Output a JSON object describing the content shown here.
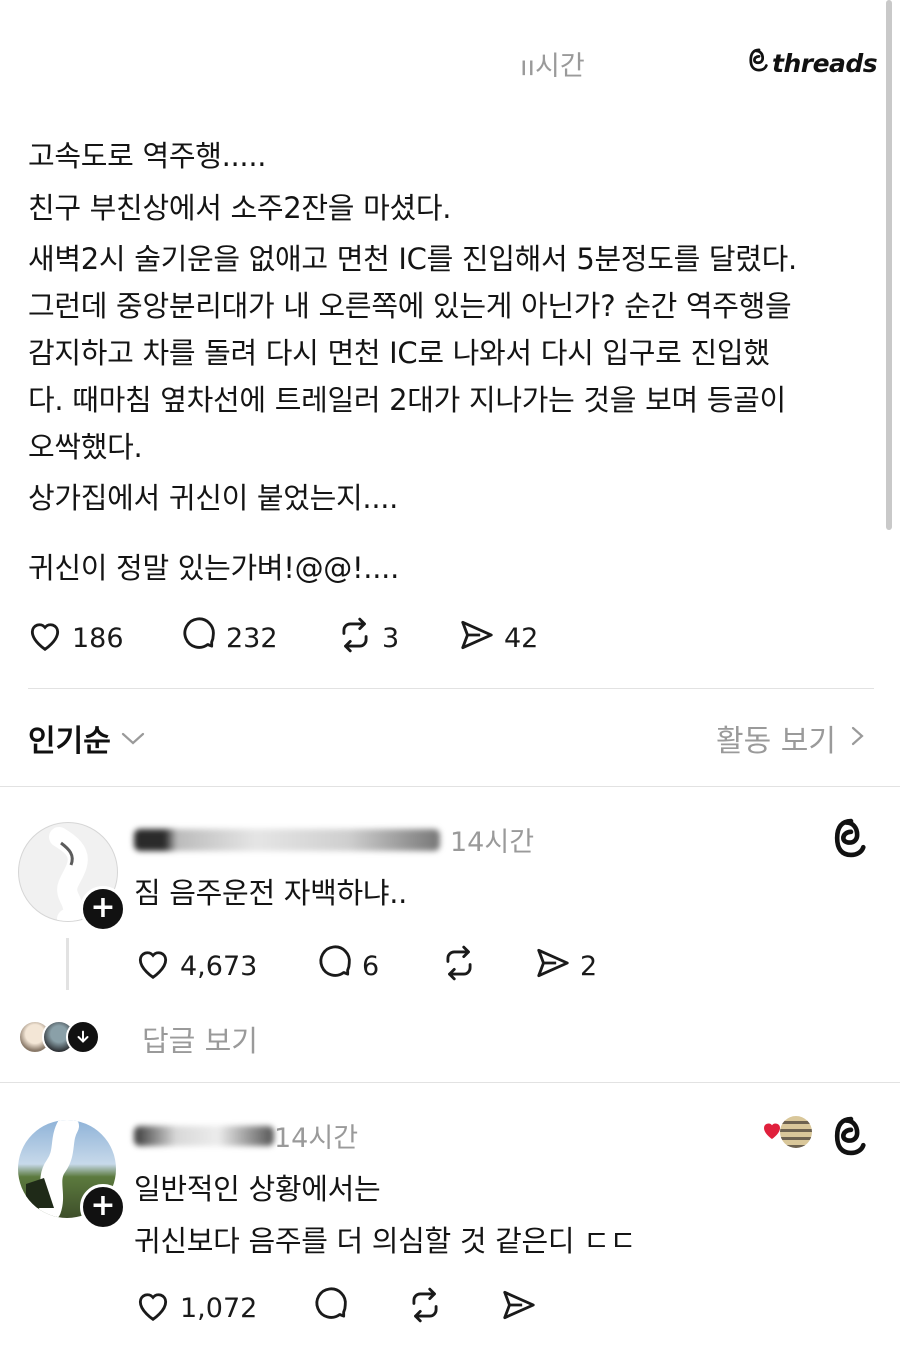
{
  "header": {
    "time": "ıı시간",
    "brand": "threads"
  },
  "post": {
    "lines": [
      "고속도로 역주행.....",
      "친구 부친상에서 소주2잔을 마셨다.",
      "새벽2시 술기운을 없애고 면천 IC를 진입해서 5분정도를 달렸다.",
      "그런데 중앙분리대가 내 오른쪽에  있는게 아닌가? 순간 역주행을",
      "감지하고 차를 돌려 다시 면천 IC로 나와서 다시 입구로 진입했",
      "다. 때마침 옆차선에 트레일러 2대가 지나가는 것을 보며 등골이",
      "오싹했다.",
      "상가집에서 귀신이 붙었는지....",
      "귀신이 정말 있는가벼!@@!...."
    ],
    "likes": "186",
    "replies": "232",
    "reposts": "3",
    "shares": "42"
  },
  "sort": {
    "label": "인기순",
    "activity_label": "활동 보기"
  },
  "comments": [
    {
      "username": "Sha... 14시간",
      "username_blur": "Sha",
      "time": "14시간",
      "text": "짐 음주운전 자백하냐..",
      "likes": "4,673",
      "replies": "6",
      "reposts": "",
      "shares": "2",
      "view_replies": "답글 보기"
    },
    {
      "username_blur": "",
      "time": "14시간",
      "lines": [
        "일반적인 상황에서는",
        "귀신보다 음주를 더 의심할 것 같은디 ㄷㄷ"
      ],
      "likes": "1,072"
    }
  ],
  "colors": {
    "text": "#141414",
    "muted": "#9a9a9a",
    "divider": "#e2e2e2",
    "heart_red": "#e0203c"
  },
  "icons": [
    "heart-icon",
    "comment-icon",
    "repost-icon",
    "share-icon",
    "chevron-down-icon",
    "chevron-right-icon",
    "threads-logo-icon",
    "follow-plus-icon",
    "arrow-down-icon"
  ]
}
